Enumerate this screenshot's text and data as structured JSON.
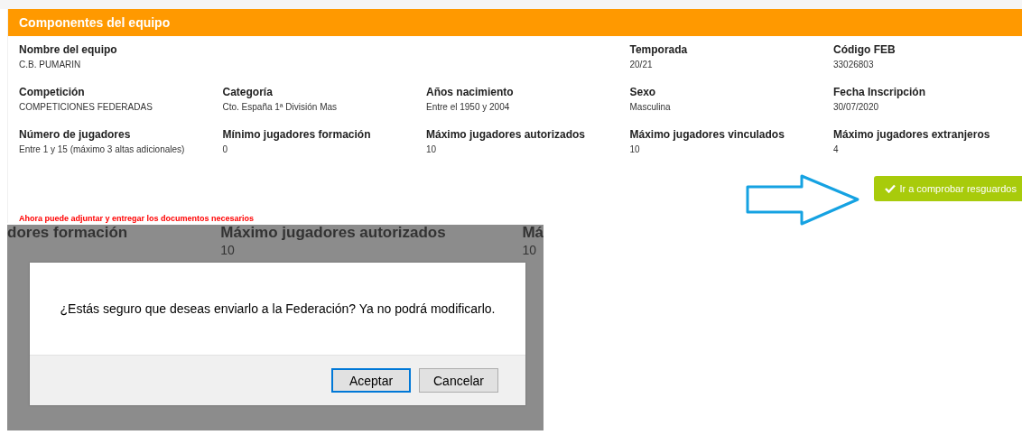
{
  "panel": {
    "title": "Componentes del equipo",
    "fields": [
      {
        "label": "Nombre del equipo",
        "value": "C.B. PUMARIN",
        "wide": true
      },
      {
        "label": "Temporada",
        "value": "20/21",
        "wide": false
      },
      {
        "label": "Código FEB",
        "value": "33026803",
        "wide": false
      },
      {
        "label": "Competición",
        "value": "COMPETICIONES FEDERADAS",
        "wide": false
      },
      {
        "label": "Categoría",
        "value": "Cto. España 1ª División Mas",
        "wide": false
      },
      {
        "label": "Años nacimiento",
        "value": "Entre el 1950 y 2004",
        "wide": false
      },
      {
        "label": "Sexo",
        "value": "Masculina",
        "wide": false
      },
      {
        "label": "Fecha Inscripción",
        "value": "30/07/2020",
        "wide": false
      },
      {
        "label": "Número de jugadores",
        "value": "Entre 1 y 15 (máximo 3 altas adicionales)",
        "wide": false
      },
      {
        "label": "Mínimo jugadores formación",
        "value": "0",
        "wide": false
      },
      {
        "label": "Máximo jugadores autorizados",
        "value": "10",
        "wide": false
      },
      {
        "label": "Máximo jugadores vinculados",
        "value": "10",
        "wide": false
      },
      {
        "label": "Máximo jugadores extranjeros",
        "value": "4",
        "wide": false
      }
    ],
    "action_button": {
      "label": "Ir a comprobar resguardos"
    },
    "notice": "Ahora puede adjuntar y entregar los documentos necesarios"
  },
  "background_screen": {
    "columns": [
      {
        "label": "dores formación"
      },
      {
        "label": "Máximo jugadores autorizados",
        "value": "10"
      },
      {
        "label": "Má",
        "value": "10"
      }
    ]
  },
  "dialog": {
    "message": "¿Estás seguro que deseas enviarlo a la Federación? Ya no podrá modificarlo.",
    "buttons": [
      {
        "label": "Aceptar",
        "focused": true
      },
      {
        "label": "Cancelar",
        "focused": false
      }
    ]
  }
}
